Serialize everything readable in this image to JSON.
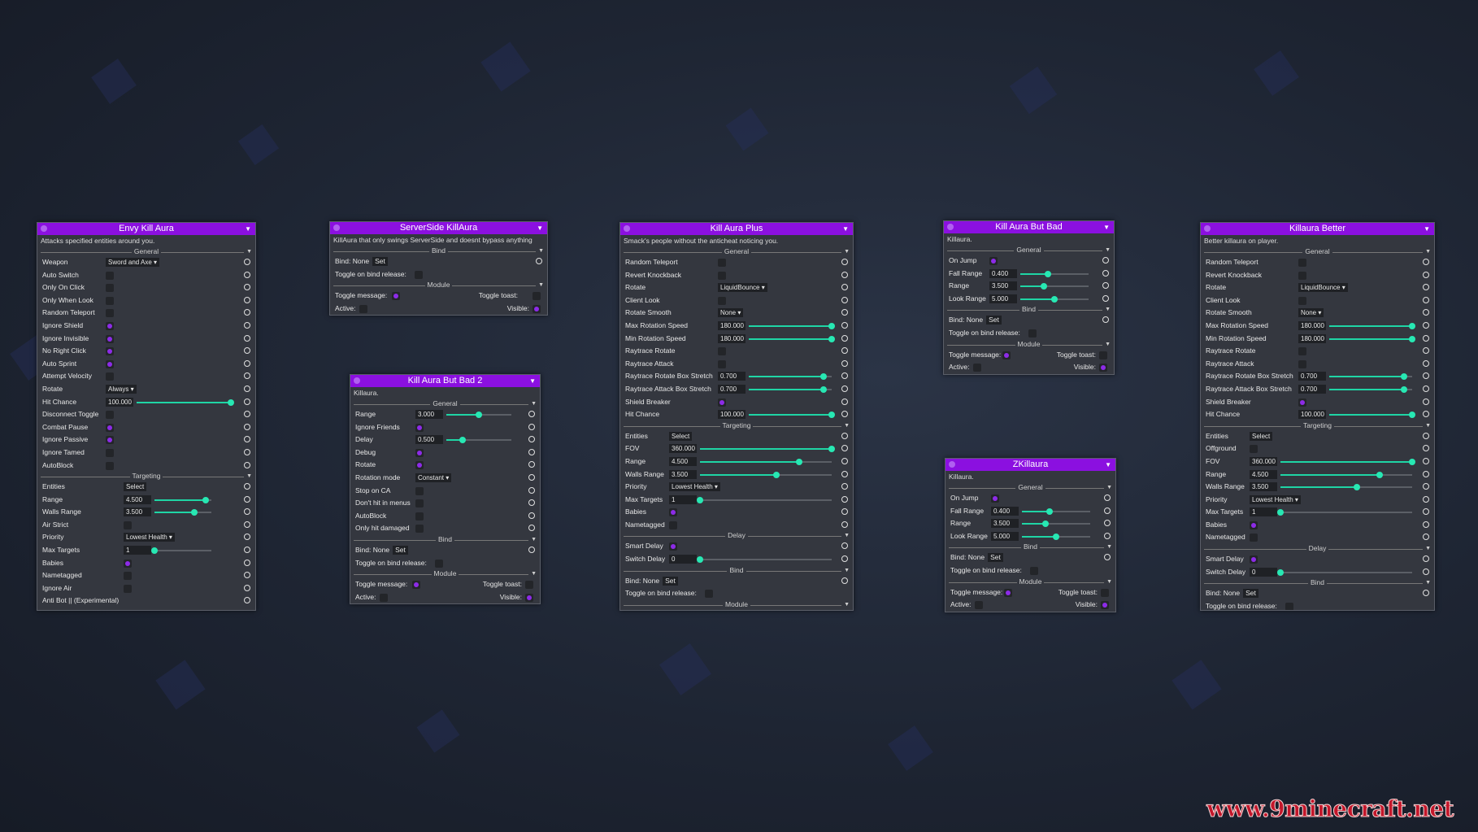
{
  "panels": {
    "envy": {
      "title": "Envy Kill Aura",
      "desc": "Attacks specified entities around you.",
      "sections": {
        "general": "General",
        "targeting": "Targeting"
      },
      "rows": {
        "weapon": {
          "label": "Weapon",
          "value": "Sword and Axe"
        },
        "auto_switch": {
          "label": "Auto Switch",
          "checked": false
        },
        "only_on_click": {
          "label": "Only On Click",
          "checked": false
        },
        "only_when_look": {
          "label": "Only When Look",
          "checked": false
        },
        "random_teleport": {
          "label": "Random Teleport",
          "checked": false
        },
        "ignore_shield": {
          "label": "Ignore Shield",
          "checked": true
        },
        "ignore_invisible": {
          "label": "Ignore Invisible",
          "checked": true
        },
        "no_right_click": {
          "label": "No Right Click",
          "checked": true
        },
        "auto_sprint": {
          "label": "Auto Sprint",
          "checked": true
        },
        "attempt_velocity": {
          "label": "Attempt Velocity",
          "checked": false
        },
        "rotate": {
          "label": "Rotate",
          "value": "Always"
        },
        "hit_chance": {
          "label": "Hit Chance",
          "value": "100.000",
          "level": 1.0
        },
        "disconnect_toggle": {
          "label": "Disconnect Toggle",
          "checked": false
        },
        "combat_pause": {
          "label": "Combat Pause",
          "checked": true
        },
        "ignore_passive": {
          "label": "Ignore Passive",
          "checked": true
        },
        "ignore_tamed": {
          "label": "Ignore Tamed",
          "checked": false
        },
        "autoblock": {
          "label": "AutoBlock",
          "checked": false
        },
        "entities": {
          "label": "Entities",
          "value": "Select"
        },
        "range": {
          "label": "Range",
          "value": "4.500",
          "level": 0.9
        },
        "walls_range": {
          "label": "Walls Range",
          "value": "3.500",
          "level": 0.7
        },
        "air_strict": {
          "label": "Air Strict",
          "checked": false
        },
        "priority": {
          "label": "Priority",
          "value": "Lowest Health"
        },
        "max_targets": {
          "label": "Max Targets",
          "value": "1",
          "level": 0.0
        },
        "babies": {
          "label": "Babies",
          "checked": true
        },
        "nametagged": {
          "label": "Nametagged",
          "checked": false
        },
        "ignore_air": {
          "label": "Ignore Air",
          "checked": false
        },
        "anti_bot": {
          "label": "Anti Bot || (Experimental)",
          "checked": false
        }
      }
    },
    "serverside": {
      "title": "ServerSide KillAura",
      "desc": "KillAura that only swings ServerSide and doesnt bypass anything",
      "sections": {
        "bind": "Bind",
        "module": "Module"
      },
      "bind": {
        "label": "Bind: None",
        "set": "Set"
      },
      "toggle_bind": {
        "label": "Toggle on bind release:"
      },
      "toggle_message": {
        "label": "Toggle message:",
        "checked": true
      },
      "toggle_toast": {
        "label": "Toggle toast:",
        "checked": false
      },
      "active": {
        "label": "Active:",
        "checked": false
      },
      "visible": {
        "label": "Visible:",
        "checked": true
      }
    },
    "badtwo": {
      "title": "Kill Aura But Bad 2",
      "desc": "Killaura.",
      "sections": {
        "general": "General",
        "bind": "Bind",
        "module": "Module"
      },
      "rows": {
        "range": {
          "label": "Range",
          "value": "3.000",
          "level": 0.5
        },
        "ignore_friends": {
          "label": "Ignore Friends",
          "checked": true
        },
        "delay": {
          "label": "Delay",
          "value": "0.500",
          "level": 0.25
        },
        "debug": {
          "label": "Debug",
          "checked": true
        },
        "rotate": {
          "label": "Rotate",
          "checked": true
        },
        "rotation_mode": {
          "label": "Rotation mode",
          "value": "Constant"
        },
        "stop_on_ca": {
          "label": "Stop on CA",
          "checked": false
        },
        "dont_hit_menus": {
          "label": "Don't hit in menus",
          "checked": false
        },
        "autoblock": {
          "label": "AutoBlock",
          "checked": false
        },
        "only_hit_damaged": {
          "label": "Only hit damaged",
          "checked": false
        }
      },
      "bind": {
        "label": "Bind: None",
        "set": "Set"
      },
      "toggle_bind": {
        "label": "Toggle on bind release:"
      },
      "toggle_message": {
        "label": "Toggle message:",
        "checked": true
      },
      "toggle_toast": {
        "label": "Toggle toast:",
        "checked": false
      },
      "active": {
        "label": "Active:",
        "checked": false
      },
      "visible": {
        "label": "Visible:",
        "checked": true
      }
    },
    "plus": {
      "title": "Kill Aura Plus",
      "desc": "Smack's people without the anticheat noticing you.",
      "sections": {
        "general": "General",
        "targeting": "Targeting",
        "delay": "Delay",
        "bind": "Bind",
        "module": "Module"
      },
      "rows": {
        "random_teleport": {
          "label": "Random Teleport",
          "checked": false
        },
        "revert_knockback": {
          "label": "Revert Knockback",
          "checked": false
        },
        "rotate": {
          "label": "Rotate",
          "value": "LiquidBounce"
        },
        "client_look": {
          "label": "Client Look",
          "checked": false
        },
        "rotate_smooth": {
          "label": "Rotate Smooth",
          "value": "None"
        },
        "max_rot": {
          "label": "Max Rotation Speed",
          "value": "180.000",
          "level": 1.0
        },
        "min_rot": {
          "label": "Min Rotation Speed",
          "value": "180.000",
          "level": 1.0
        },
        "raytrace_rotate": {
          "label": "Raytrace Rotate",
          "checked": false
        },
        "raytrace_attack": {
          "label": "Raytrace Attack",
          "checked": false
        },
        "rr_box": {
          "label": "Raytrace Rotate Box Stretch",
          "value": "0.700",
          "level": 0.9
        },
        "ra_box": {
          "label": "Raytrace Attack Box Stretch",
          "value": "0.700",
          "level": 0.9
        },
        "shield_breaker": {
          "label": "Shield Breaker",
          "checked": true
        },
        "hit_chance": {
          "label": "Hit Chance",
          "value": "100.000",
          "level": 1.0
        },
        "entities": {
          "label": "Entities",
          "value": "Select"
        },
        "fov": {
          "label": "FOV",
          "value": "360.000",
          "level": 1.0
        },
        "range": {
          "label": "Range",
          "value": "4.500",
          "level": 0.75
        },
        "walls_range": {
          "label": "Walls Range",
          "value": "3.500",
          "level": 0.58
        },
        "priority": {
          "label": "Priority",
          "value": "Lowest Health"
        },
        "max_targets": {
          "label": "Max Targets",
          "value": "1",
          "level": 0.0
        },
        "babies": {
          "label": "Babies",
          "checked": true
        },
        "nametagged": {
          "label": "Nametagged",
          "checked": false
        },
        "smart_delay": {
          "label": "Smart Delay",
          "checked": true
        },
        "switch_delay": {
          "label": "Switch Delay",
          "value": "0",
          "level": 0.0
        }
      },
      "bind": {
        "label": "Bind: None",
        "set": "Set"
      },
      "toggle_bind": {
        "label": "Toggle on bind release:"
      }
    },
    "bad": {
      "title": "Kill Aura But Bad",
      "desc": "Killaura.",
      "sections": {
        "general": "General",
        "bind": "Bind",
        "module": "Module"
      },
      "rows": {
        "on_jump": {
          "label": "On Jump",
          "checked": true
        },
        "fall_range": {
          "label": "Fall Range",
          "value": "0.400",
          "level": 0.4
        },
        "range": {
          "label": "Range",
          "value": "3.500",
          "level": 0.35
        },
        "look_range": {
          "label": "Look Range",
          "value": "5.000",
          "level": 0.5
        }
      },
      "bind": {
        "label": "Bind: None",
        "set": "Set"
      },
      "toggle_bind": {
        "label": "Toggle on bind release:"
      },
      "toggle_message": {
        "label": "Toggle message:",
        "checked": true
      },
      "toggle_toast": {
        "label": "Toggle toast:",
        "checked": false
      },
      "active": {
        "label": "Active:",
        "checked": false
      },
      "visible": {
        "label": "Visible:",
        "checked": true
      }
    },
    "zk": {
      "title": "ZKillaura",
      "desc": "Killaura.",
      "sections": {
        "general": "General",
        "bind": "Bind",
        "module": "Module"
      },
      "rows": {
        "on_jump": {
          "label": "On Jump",
          "checked": true
        },
        "fall_range": {
          "label": "Fall Range",
          "value": "0.400",
          "level": 0.4
        },
        "range": {
          "label": "Range",
          "value": "3.500",
          "level": 0.35
        },
        "look_range": {
          "label": "Look Range",
          "value": "5.000",
          "level": 0.5
        }
      },
      "bind": {
        "label": "Bind: None",
        "set": "Set"
      },
      "toggle_bind": {
        "label": "Toggle on bind release:"
      },
      "toggle_message": {
        "label": "Toggle message:",
        "checked": true
      },
      "toggle_toast": {
        "label": "Toggle toast:",
        "checked": false
      },
      "active": {
        "label": "Active:",
        "checked": false
      },
      "visible": {
        "label": "Visible:",
        "checked": true
      }
    },
    "better": {
      "title": "Killaura Better",
      "desc": "Better killaura on player.",
      "sections": {
        "general": "General",
        "targeting": "Targeting",
        "delay": "Delay",
        "bind": "Bind"
      },
      "rows": {
        "random_teleport": {
          "label": "Random Teleport",
          "checked": false
        },
        "revert_knockback": {
          "label": "Revert Knockback",
          "checked": false
        },
        "rotate": {
          "label": "Rotate",
          "value": "LiquidBounce"
        },
        "client_look": {
          "label": "Client Look",
          "checked": false
        },
        "rotate_smooth": {
          "label": "Rotate Smooth",
          "value": "None"
        },
        "max_rot": {
          "label": "Max Rotation Speed",
          "value": "180.000",
          "level": 1.0
        },
        "min_rot": {
          "label": "Min Rotation Speed",
          "value": "180.000",
          "level": 1.0
        },
        "raytrace_rotate": {
          "label": "Raytrace Rotate",
          "checked": false
        },
        "raytrace_attack": {
          "label": "Raytrace Attack",
          "checked": false
        },
        "rr_box": {
          "label": "Raytrace Rotate Box Stretch",
          "value": "0.700",
          "level": 0.9
        },
        "ra_box": {
          "label": "Raytrace Attack Box Stretch",
          "value": "0.700",
          "level": 0.9
        },
        "shield_breaker": {
          "label": "Shield Breaker",
          "checked": true
        },
        "hit_chance": {
          "label": "Hit Chance",
          "value": "100.000",
          "level": 1.0
        },
        "entities": {
          "label": "Entities",
          "value": "Select"
        },
        "offground": {
          "label": "Offground",
          "checked": false
        },
        "fov": {
          "label": "FOV",
          "value": "360.000",
          "level": 1.0
        },
        "range": {
          "label": "Range",
          "value": "4.500",
          "level": 0.75
        },
        "walls_range": {
          "label": "Walls Range",
          "value": "3.500",
          "level": 0.58
        },
        "priority": {
          "label": "Priority",
          "value": "Lowest Health"
        },
        "max_targets": {
          "label": "Max Targets",
          "value": "1",
          "level": 0.0
        },
        "babies": {
          "label": "Babies",
          "checked": true
        },
        "nametagged": {
          "label": "Nametagged",
          "checked": false
        },
        "smart_delay": {
          "label": "Smart Delay",
          "checked": true
        },
        "switch_delay": {
          "label": "Switch Delay",
          "value": "0",
          "level": 0.0
        }
      },
      "bind": {
        "label": "Bind: None",
        "set": "Set"
      },
      "toggle_bind": {
        "label": "Toggle on bind release:"
      }
    }
  },
  "watermark": "www.9minecraft.net",
  "colors": {
    "accent": "#8b10e0",
    "slider": "#27e8b3",
    "check": "#8d2be8",
    "watermark": "#c3172b"
  }
}
